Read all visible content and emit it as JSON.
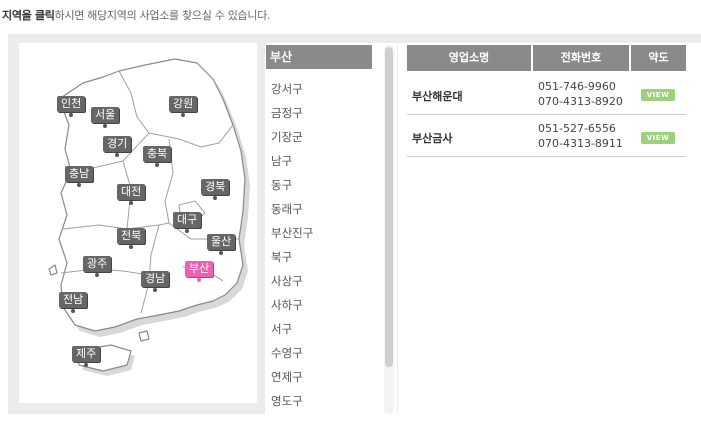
{
  "instruction": {
    "highlight": "지역을 클릭",
    "rest": "하시면 해당지역의 사업소를 찾으실 수 있습니다."
  },
  "map": {
    "regions": [
      {
        "key": "incheon",
        "label": "인천",
        "active": false
      },
      {
        "key": "seoul",
        "label": "서울",
        "active": false
      },
      {
        "key": "gangwon",
        "label": "강원",
        "active": false
      },
      {
        "key": "gyeonggi",
        "label": "경기",
        "active": false
      },
      {
        "key": "chungbuk",
        "label": "충북",
        "active": false
      },
      {
        "key": "chungnam",
        "label": "충남",
        "active": false
      },
      {
        "key": "daejeon",
        "label": "대전",
        "active": false
      },
      {
        "key": "gyeongbuk",
        "label": "경북",
        "active": false
      },
      {
        "key": "daegu",
        "label": "대구",
        "active": false
      },
      {
        "key": "jeonbuk",
        "label": "전북",
        "active": false
      },
      {
        "key": "ulsan",
        "label": "울산",
        "active": false
      },
      {
        "key": "gwangju",
        "label": "광주",
        "active": false
      },
      {
        "key": "busan",
        "label": "부산",
        "active": true
      },
      {
        "key": "gyeongnam",
        "label": "경남",
        "active": false
      },
      {
        "key": "jeonnam",
        "label": "전남",
        "active": false
      },
      {
        "key": "jeju",
        "label": "제주",
        "active": false
      }
    ],
    "active_color": "#f060b0",
    "marker_color": "#666666"
  },
  "districts": {
    "header": "부산",
    "items": [
      "강서구",
      "금정구",
      "기장군",
      "남구",
      "동구",
      "동래구",
      "부산진구",
      "북구",
      "사상구",
      "사하구",
      "서구",
      "수영구",
      "연제구",
      "영도구"
    ]
  },
  "table": {
    "headers": {
      "name": "영업소명",
      "phone": "전화번호",
      "map": "약도"
    },
    "rows": [
      {
        "name": "부산해운대",
        "phone1": "051-746-9960",
        "phone2": "070-4313-8920",
        "view": "VIEW"
      },
      {
        "name": "부산금사",
        "phone1": "051-527-6556",
        "phone2": "070-4313-8911",
        "view": "VIEW"
      }
    ],
    "view_color": "#9ed27a"
  }
}
